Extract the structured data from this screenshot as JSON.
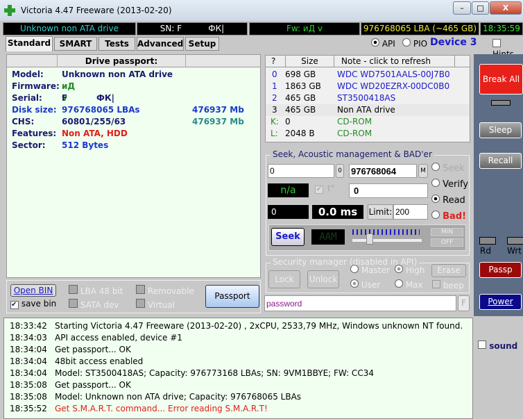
{
  "window": {
    "title": "Victoria 4.47  Freeware (2013-02-20)",
    "minimize": "–",
    "maximize": "□",
    "close": "X"
  },
  "status": {
    "drive": "Unknown non ATA drive",
    "sn": "SN: F          ФК|",
    "fw": "Fw: иД v",
    "lba": "976768065 LBA (~465 GB)",
    "time": "18:35:59"
  },
  "tabs": [
    "Standard",
    "SMART",
    "Tests",
    "Advanced",
    "Setup"
  ],
  "mode": {
    "api": "API",
    "pio": "PIO",
    "device": "Device 3",
    "hints": "Hints"
  },
  "passport": {
    "header": "Drive passport:",
    "rows": [
      {
        "label": "Model:",
        "value": "Unknown non ATA drive",
        "extra": ""
      },
      {
        "label": "Firmware:",
        "value": "иД v",
        "extra": ""
      },
      {
        "label": "Serial:",
        "value": "F          ФК|",
        "extra": ""
      },
      {
        "label": "Disk size:",
        "value": "976768065 LBAs",
        "extra": "476937 Mb"
      },
      {
        "label": "CHS:",
        "value": "60801/255/63",
        "extra": "476937 Mb"
      },
      {
        "label": "Features:",
        "value": "Non ATA, HDD",
        "extra": ""
      },
      {
        "label": "Sector:",
        "value": "512 Bytes",
        "extra": ""
      }
    ]
  },
  "drives": {
    "headers": [
      "?",
      "Size",
      "Note - click to refresh"
    ],
    "rows": [
      {
        "id": "0",
        "size": "698 GB",
        "note": "WDC WD7501AALS-00J7B0"
      },
      {
        "id": "1",
        "size": "1863 GB",
        "note": "WDC WD20EZRX-00DC0B0"
      },
      {
        "id": "2",
        "size": "465 GB",
        "note": "ST3500418AS"
      },
      {
        "id": "3",
        "size": "465 GB",
        "note": "Non ATA drive"
      },
      {
        "id": "K:",
        "size": "0",
        "note": "CD-ROM"
      },
      {
        "id": "L:",
        "size": "2048 B",
        "note": "CD-ROM"
      }
    ]
  },
  "seek": {
    "title": "Seek, Acoustic management & BAD'er",
    "start": "0",
    "start_btn": "0",
    "end": "976768064",
    "end_btn": "M",
    "temp": "n/a",
    "temp_label": "t°",
    "value": "0",
    "counter": "0",
    "ms": "0.0 ms",
    "limit_label": "Limit:",
    "limit": "200",
    "modes": [
      "Seek",
      "Verify",
      "Read",
      "Bad!"
    ],
    "seek_btn": "Seek",
    "aam": "AAM",
    "min": "MIN",
    "off": "OFF"
  },
  "security": {
    "title": "Security manager (disabled in API)",
    "lock": "Lock",
    "unlock": "Unlock",
    "master": "Master",
    "user": "User",
    "high": "High",
    "max": "Max",
    "erase": "Erase",
    "beep": "beep"
  },
  "password": {
    "value": "password",
    "f_btn": "F"
  },
  "bottom": {
    "open_bin": "Open BIN",
    "save_bin": "save bin",
    "lba48": "LBA 48 bit",
    "removable": "Removable",
    "sata": "SATA dev",
    "virtual": "Virtual",
    "passport": "Passport"
  },
  "sidebar": {
    "break_all": "Break All",
    "sleep": "Sleep",
    "recall": "Recall",
    "rd": "Rd",
    "wrt": "Wrt",
    "passp": "Passp",
    "power": "Power",
    "sound": "sound"
  },
  "log": [
    {
      "time": "18:33:42",
      "text": "Starting Victoria 4.47  Freeware (2013-02-20) , 2xCPU, 2533,79 MHz, Windows unknown NT found."
    },
    {
      "time": "18:34:03",
      "text": "API access enabled, device #1"
    },
    {
      "time": "18:34:04",
      "text": "Get passport... OK"
    },
    {
      "time": "18:34:04",
      "text": "48bit access enabled"
    },
    {
      "time": "18:34:04",
      "text": "Model: ST3500418AS; Capacity: 976773168 LBAs; SN: 9VM1BBYE; FW: CC34"
    },
    {
      "time": "18:35:08",
      "text": "Get passport... OK"
    },
    {
      "time": "18:35:08",
      "text": "Model: Unknown non ATA drive; Capacity: 976768065 LBAs"
    },
    {
      "time": "18:35:52",
      "text": "Get S.M.A.R.T. command... Error reading S.M.A.R.T!"
    }
  ]
}
